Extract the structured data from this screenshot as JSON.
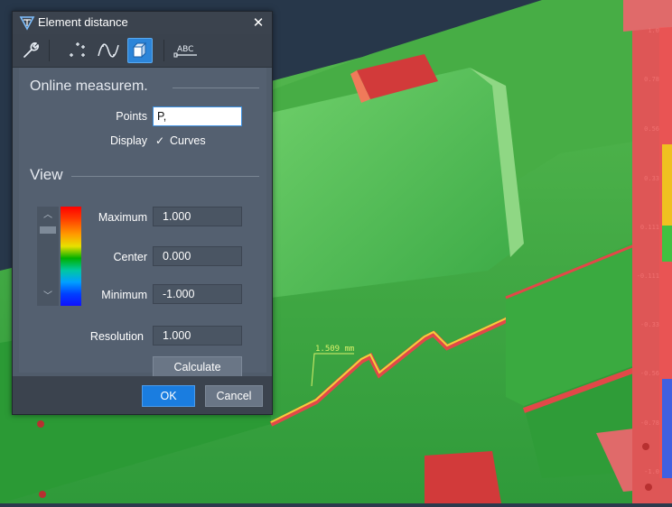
{
  "dialog": {
    "title": "Element distance",
    "close_glyph": "✕",
    "toolbar": [
      {
        "icon": "wrench-icon"
      },
      {
        "icon": "point-cloud-icon"
      },
      {
        "icon": "curve-icon"
      },
      {
        "icon": "cube-icon",
        "active": true
      },
      {
        "icon": "label-abc-icon",
        "text": "ABC"
      }
    ]
  },
  "online": {
    "section_title": "Online measurem.",
    "points_label": "Points",
    "points_value": "P,",
    "display_label": "Display",
    "curves_checked": true,
    "curves_label": "Curves"
  },
  "view": {
    "section_title": "View",
    "maximum_label": "Maximum",
    "maximum_value": "1.000",
    "center_label": "Center",
    "center_value": "0.000",
    "minimum_label": "Minimum",
    "minimum_value": "-1.000",
    "resolution_label": "Resolution",
    "resolution_value": "1.000",
    "calculate_label": "Calculate"
  },
  "footer": {
    "ok_label": "OK",
    "cancel_label": "Cancel"
  },
  "viewport": {
    "dimension_label": "1.509 mm",
    "scale_ticks": [
      "1.0",
      "0.78",
      "0.56",
      "0.33",
      "0.111",
      "-0.111",
      "-0.33",
      "-0.56",
      "-0.78",
      "-1.0"
    ]
  },
  "colors": {
    "accent": "#2c85d9",
    "part_green": "#2fa53c",
    "part_red": "#d84848"
  }
}
